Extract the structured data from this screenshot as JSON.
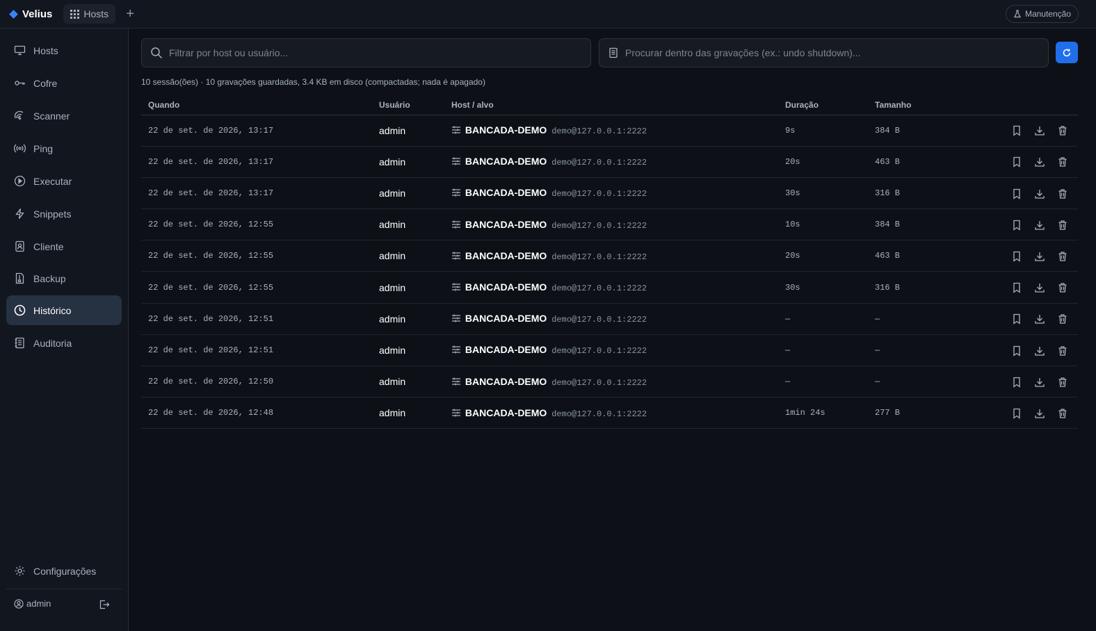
{
  "app": {
    "name": "Velius",
    "tab_label": "Hosts",
    "new_tab": "+",
    "maintenance_label": "Manutenção"
  },
  "sidebar": {
    "items": [
      {
        "label": "Hosts",
        "icon": "monitor-icon"
      },
      {
        "label": "Cofre",
        "icon": "key-icon"
      },
      {
        "label": "Scanner",
        "icon": "radar-icon"
      },
      {
        "label": "Ping",
        "icon": "broadcast-icon"
      },
      {
        "label": "Executar",
        "icon": "play-circle-icon"
      },
      {
        "label": "Snippets",
        "icon": "lightning-icon"
      },
      {
        "label": "Cliente",
        "icon": "contact-card-icon"
      },
      {
        "label": "Backup",
        "icon": "file-archive-icon"
      },
      {
        "label": "Histórico",
        "icon": "clock-icon",
        "active": true
      },
      {
        "label": "Auditoria",
        "icon": "journal-icon"
      }
    ],
    "settings_label": "Configurações",
    "user_label": "admin"
  },
  "filters": {
    "host_placeholder": "Filtrar por host ou usuário...",
    "recording_placeholder": "Procurar dentro das gravações (ex.: undo shutdown)..."
  },
  "summary": "10 sessão(ões) · 10 gravações guardadas, 3.4 KB em disco (compactadas; nada é apagado)",
  "table": {
    "headers": {
      "when": "Quando",
      "user": "Usuário",
      "host": "Host / alvo",
      "duration": "Duração",
      "size": "Tamanho"
    },
    "rows": [
      {
        "when": "22 de set. de 2026, 13:17",
        "user": "admin",
        "host": "BANCADA-DEMO",
        "target": "demo@127.0.0.1:2222",
        "duration": "9s",
        "size": "384 B"
      },
      {
        "when": "22 de set. de 2026, 13:17",
        "user": "admin",
        "host": "BANCADA-DEMO",
        "target": "demo@127.0.0.1:2222",
        "duration": "20s",
        "size": "463 B"
      },
      {
        "when": "22 de set. de 2026, 13:17",
        "user": "admin",
        "host": "BANCADA-DEMO",
        "target": "demo@127.0.0.1:2222",
        "duration": "30s",
        "size": "316 B"
      },
      {
        "when": "22 de set. de 2026, 12:55",
        "user": "admin",
        "host": "BANCADA-DEMO",
        "target": "demo@127.0.0.1:2222",
        "duration": "10s",
        "size": "384 B"
      },
      {
        "when": "22 de set. de 2026, 12:55",
        "user": "admin",
        "host": "BANCADA-DEMO",
        "target": "demo@127.0.0.1:2222",
        "duration": "20s",
        "size": "463 B"
      },
      {
        "when": "22 de set. de 2026, 12:55",
        "user": "admin",
        "host": "BANCADA-DEMO",
        "target": "demo@127.0.0.1:2222",
        "duration": "30s",
        "size": "316 B"
      },
      {
        "when": "22 de set. de 2026, 12:51",
        "user": "admin",
        "host": "BANCADA-DEMO",
        "target": "demo@127.0.0.1:2222",
        "duration": "—",
        "size": "—"
      },
      {
        "when": "22 de set. de 2026, 12:51",
        "user": "admin",
        "host": "BANCADA-DEMO",
        "target": "demo@127.0.0.1:2222",
        "duration": "—",
        "size": "—"
      },
      {
        "when": "22 de set. de 2026, 12:50",
        "user": "admin",
        "host": "BANCADA-DEMO",
        "target": "demo@127.0.0.1:2222",
        "duration": "—",
        "size": "—"
      },
      {
        "when": "22 de set. de 2026, 12:48",
        "user": "admin",
        "host": "BANCADA-DEMO",
        "target": "demo@127.0.0.1:2222",
        "duration": "1min 24s",
        "size": "277 B"
      }
    ]
  },
  "colors": {
    "accent": "#1f6feb",
    "brand": "#3b82f6",
    "background": "#0d1117",
    "sidebar": "#12161e",
    "active_item": "#263142"
  }
}
